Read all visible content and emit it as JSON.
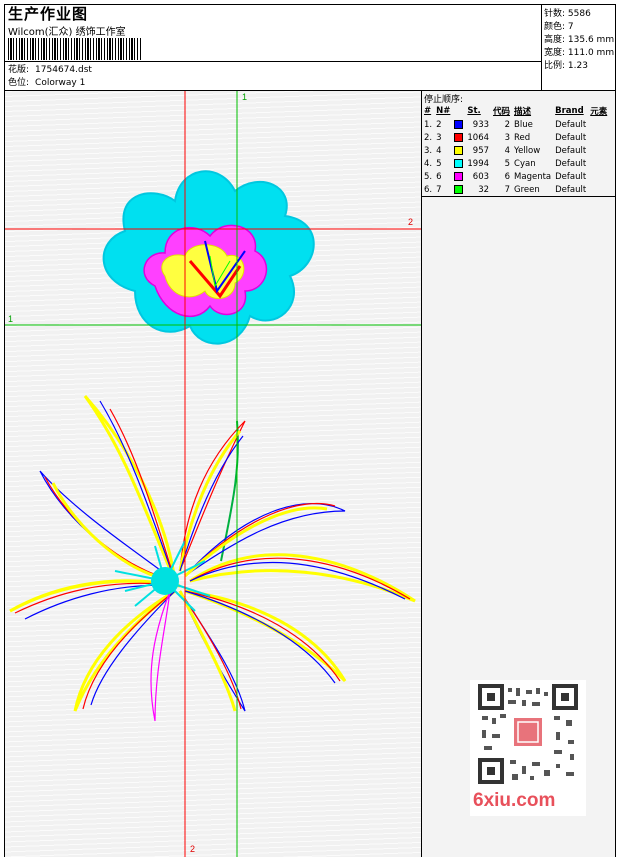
{
  "header": {
    "title": "生产作业图",
    "subtitle": "Wilcom(汇众) 绣饰工作室",
    "design": {
      "label": "花版:",
      "value": "1754674.dst"
    },
    "colorway": {
      "label": "色位:",
      "value": "Colorway 1"
    }
  },
  "stats": [
    {
      "label": "针数:",
      "value": "5586"
    },
    {
      "label": "颜色:",
      "value": "7"
    },
    {
      "label": "高度:",
      "value": "135.6 mm"
    },
    {
      "label": "宽度:",
      "value": "111.0 mm"
    },
    {
      "label": "比例:",
      "value": "1.23"
    }
  ],
  "stop_sequence": {
    "title": "停止顺序:",
    "columns": [
      "#",
      "N#",
      "St.",
      "代码",
      "描述",
      "Brand",
      "元素"
    ],
    "rows": [
      {
        "idx": "1.",
        "n": "2",
        "color": "#0000ff",
        "st": "933",
        "code": "2",
        "desc": "Blue",
        "brand": "Default"
      },
      {
        "idx": "2.",
        "n": "3",
        "color": "#ff0000",
        "st": "1064",
        "code": "3",
        "desc": "Red",
        "brand": "Default"
      },
      {
        "idx": "3.",
        "n": "4",
        "color": "#ffff00",
        "st": "957",
        "code": "4",
        "desc": "Yellow",
        "brand": "Default"
      },
      {
        "idx": "4.",
        "n": "5",
        "color": "#00ffff",
        "st": "1994",
        "code": "5",
        "desc": "Cyan",
        "brand": "Default"
      },
      {
        "idx": "5.",
        "n": "6",
        "color": "#ff00ff",
        "st": "603",
        "code": "6",
        "desc": "Magenta",
        "brand": "Default"
      },
      {
        "idx": "6.",
        "n": "7",
        "color": "#00ff00",
        "st": "32",
        "code": "7",
        "desc": "Green",
        "brand": "Default"
      }
    ]
  },
  "canvas": {
    "axis_labels": {
      "green_top": "1",
      "red_right": "2",
      "green_left": "1",
      "red_bottom": "2"
    },
    "watermark": "6xiu.com"
  }
}
